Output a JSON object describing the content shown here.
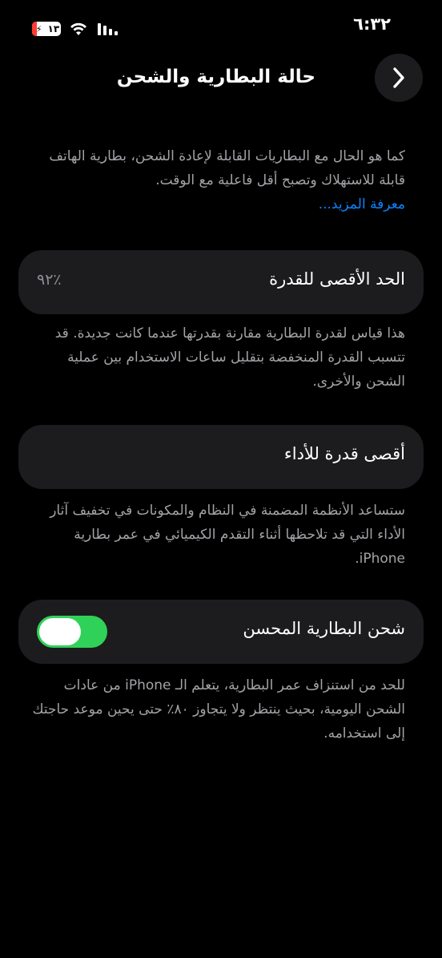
{
  "status_bar": {
    "time": "٦:٣٢",
    "battery_level": "١٣",
    "battery_color": "#ff3b30"
  },
  "header": {
    "title": "حالة البطارية والشحن",
    "back_icon": "chevron-right-icon"
  },
  "intro": {
    "text": "كما هو الحال مع البطاريات القابلة لإعادة الشحن، بطارية الهاتف قابلة للاستهلاك وتصبح أقل فاعلية مع الوقت.",
    "link_label": "معرفة المزيد..."
  },
  "maximum_capacity": {
    "label": "الحد الأقصى للقدرة",
    "value": "٪٩٢",
    "description": "هذا قياس لقدرة البطارية مقارنة بقدرتها عندما كانت جديدة. قد تتسبب القدرة المنخفضة بتقليل ساعات الاستخدام بين عملية الشحن والأخرى."
  },
  "peak_performance": {
    "label": "أقصى قدرة للأداء",
    "description": "ستساعد الأنظمة المضمنة في النظام والمكونات في تخفيف آثار الأداء التي قد تلاحظها أثناء التقدم الكيميائي في عمر بطارية iPhone."
  },
  "optimized_charging": {
    "label": "شحن البطارية المحسن",
    "enabled": true,
    "toggle_color": "#30d158",
    "description": "للحد من استنزاف عمر البطارية، يتعلم الـ iPhone من عادات الشحن اليومية، بحيث ينتظر ولا يتجاوز ٨٠٪ حتى يحين موعد حاجتك إلى استخدامه."
  },
  "colors": {
    "background": "#000000",
    "card": "#1c1c1e",
    "secondary_text": "#a3a3a8",
    "link": "#0a84ff"
  }
}
